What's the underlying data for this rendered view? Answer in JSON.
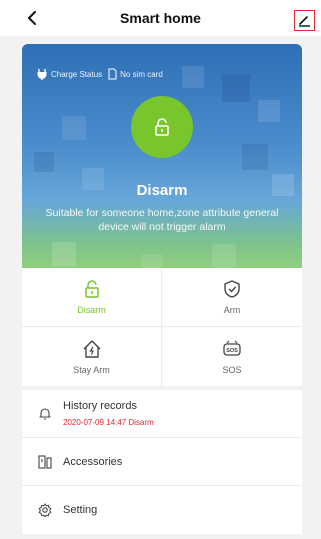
{
  "header": {
    "title": "Smart home"
  },
  "hero": {
    "charge_status": "Charge Status",
    "sim_status": "No sim card",
    "state_title": "Disarm",
    "state_desc": "Suitable for someone home,zone attribute general device will not trigger alarm",
    "accent_color": "#78c62c"
  },
  "modes": [
    {
      "label": "Disarm",
      "icon": "unlock-icon",
      "active": true
    },
    {
      "label": "Arm",
      "icon": "shield-check-icon",
      "active": false
    },
    {
      "label": "Stay Arm",
      "icon": "home-bolt-icon",
      "active": false
    },
    {
      "label": "SOS",
      "icon": "sos-icon",
      "active": false
    }
  ],
  "menu": {
    "history": {
      "label": "History records",
      "sub": "2020-07-09 14:47 Disarm"
    },
    "accessories": {
      "label": "Accessories"
    },
    "setting": {
      "label": "Setting"
    }
  }
}
